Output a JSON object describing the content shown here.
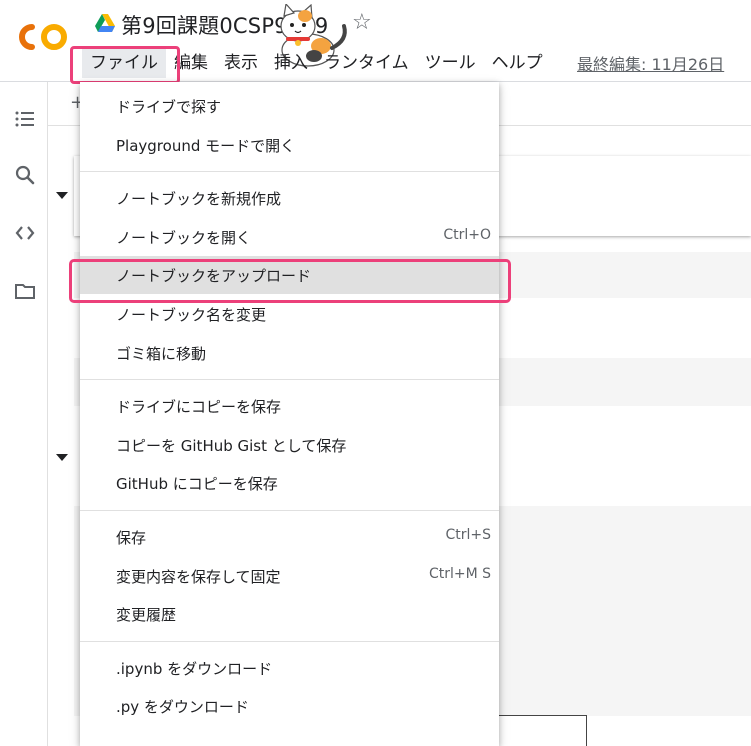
{
  "app": {
    "title": "第9回課題0CSP9999",
    "last_edit": "最終編集: 11月26日"
  },
  "menubar": [
    {
      "label": "ファイル",
      "active": true
    },
    {
      "label": "編集"
    },
    {
      "label": "表示"
    },
    {
      "label": "挿入"
    },
    {
      "label": "ランタイム"
    },
    {
      "label": "ツール"
    },
    {
      "label": "ヘルプ"
    }
  ],
  "toolbar": {
    "add_label": "+"
  },
  "rail_icons": [
    "table-of-contents-icon",
    "search-icon",
    "code-snippets-icon",
    "files-icon"
  ],
  "file_menu": {
    "groups": [
      [
        {
          "label": "ドライブで探す",
          "shortcut": ""
        },
        {
          "label": "Playground モードで開く",
          "shortcut": ""
        }
      ],
      [
        {
          "label": "ノートブックを新規作成",
          "shortcut": ""
        },
        {
          "label": "ノートブックを開く",
          "shortcut": "Ctrl+O"
        },
        {
          "label": "ノートブックをアップロード",
          "shortcut": "",
          "hover": true
        },
        {
          "label": "ノートブック名を変更",
          "shortcut": ""
        },
        {
          "label": "ゴミ箱に移動",
          "shortcut": ""
        }
      ],
      [
        {
          "label": "ドライブにコピーを保存",
          "shortcut": ""
        },
        {
          "label": "コピーを GitHub Gist として保存",
          "shortcut": ""
        },
        {
          "label": "GitHub にコピーを保存",
          "shortcut": ""
        }
      ],
      [
        {
          "label": "保存",
          "shortcut": "Ctrl+S"
        },
        {
          "label": "変更内容を保存して固定",
          "shortcut": "Ctrl+M S"
        },
        {
          "label": "変更履歴",
          "shortcut": ""
        }
      ],
      [
        {
          "label": ".ipynb をダウンロード",
          "shortcut": ""
        },
        {
          "label": ".py をダウンロード",
          "shortcut": ""
        }
      ]
    ]
  },
  "colors": {
    "highlight": "#ec407a",
    "hover_bg": "#e0e0e0",
    "logo_orange": "#f9ab00",
    "logo_amber": "#e8710a"
  }
}
